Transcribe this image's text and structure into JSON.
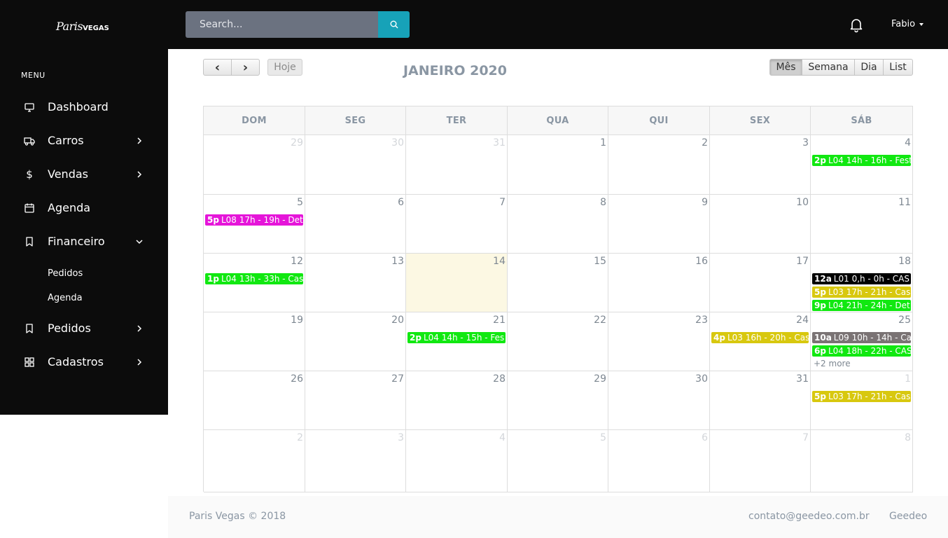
{
  "app": {
    "logo_script": "Paris",
    "logo_word": "VEGAS",
    "search_placeholder": "Search...",
    "user_name": "Fabio"
  },
  "sidebar": {
    "menu_title": "MENU",
    "items": [
      {
        "label": "Dashboard",
        "icon": "monitor-icon",
        "chevron": "none"
      },
      {
        "label": "Carros",
        "icon": "truck-icon",
        "chevron": "right"
      },
      {
        "label": "Vendas",
        "icon": "dollar-icon",
        "chevron": "right"
      },
      {
        "label": "Agenda",
        "icon": "calendar-icon",
        "chevron": "none"
      },
      {
        "label": "Financeiro",
        "icon": "bookmark-icon",
        "chevron": "down"
      },
      {
        "label": "Pedidos",
        "icon": "bookmark-icon",
        "chevron": "right"
      },
      {
        "label": "Cadastros",
        "icon": "grid-icon",
        "chevron": "right"
      }
    ],
    "subitems": [
      "Pedidos",
      "Agenda"
    ]
  },
  "calendar": {
    "prev_label": "‹",
    "next_label": "›",
    "today_label": "Hoje",
    "title": "JANEIRO 2020",
    "views": [
      "Mês",
      "Semana",
      "Dia",
      "List"
    ],
    "active_view": "Mês",
    "weekdays": [
      "DOM",
      "SEG",
      "TER",
      "QUA",
      "QUI",
      "SEX",
      "SÁB"
    ],
    "weeks": [
      [
        "29",
        "30",
        "31",
        "1",
        "2",
        "3",
        "4"
      ],
      [
        "5",
        "6",
        "7",
        "8",
        "9",
        "10",
        "11"
      ],
      [
        "12",
        "13",
        "14",
        "15",
        "16",
        "17",
        "18"
      ],
      [
        "19",
        "20",
        "21",
        "22",
        "23",
        "24",
        "25"
      ],
      [
        "26",
        "27",
        "28",
        "29",
        "30",
        "31",
        "1"
      ],
      [
        "2",
        "3",
        "4",
        "5",
        "6",
        "7",
        "8"
      ]
    ],
    "today": "14",
    "events": [
      {
        "week": 0,
        "day": 6,
        "slot": 0,
        "time": "2p",
        "text": "L04 14h - 16h - Fest",
        "color": "#11e811"
      },
      {
        "week": 1,
        "day": 0,
        "slot": 0,
        "time": "5p",
        "text": "L08 17h - 19h - Det",
        "color": "#e515d9"
      },
      {
        "week": 2,
        "day": 0,
        "slot": 0,
        "time": "1p",
        "text": "L04 13h - 33h - Cas",
        "color": "#11e811"
      },
      {
        "week": 2,
        "day": 6,
        "slot": 0,
        "time": "12a",
        "text": "L01 0,h - 0h - CAS",
        "color": "#000000"
      },
      {
        "week": 2,
        "day": 6,
        "slot": 1,
        "time": "5p",
        "text": "L03 17h - 21h - Cas",
        "color": "#d8c80f"
      },
      {
        "week": 2,
        "day": 6,
        "slot": 2,
        "time": "9p",
        "text": "L04 21h - 24h - Det",
        "color": "#11e811"
      },
      {
        "week": 3,
        "day": 2,
        "slot": 0,
        "time": "2p",
        "text": "L04 14h - 15h - Fes",
        "color": "#11e811"
      },
      {
        "week": 3,
        "day": 5,
        "slot": 0,
        "time": "4p",
        "text": "L03 16h - 20h - Cas",
        "color": "#d8c80f"
      },
      {
        "week": 3,
        "day": 6,
        "slot": 0,
        "time": "10a",
        "text": "L09 10h - 14h - Ca",
        "color": "#7a7374"
      },
      {
        "week": 3,
        "day": 6,
        "slot": 1,
        "time": "6p",
        "text": "L04 18h - 22h - CAS",
        "color": "#11e811"
      },
      {
        "week": 4,
        "day": 6,
        "slot": 0,
        "time": "5p",
        "text": "L03 17h - 21h - Cas",
        "color": "#d8c80f"
      }
    ],
    "more": [
      {
        "week": 3,
        "day": 6,
        "label": "+2 more"
      }
    ]
  },
  "footer": {
    "copyright": "Paris Vegas © 2018",
    "email": "contato@geedeo.com.br",
    "brand": "Geedeo"
  }
}
